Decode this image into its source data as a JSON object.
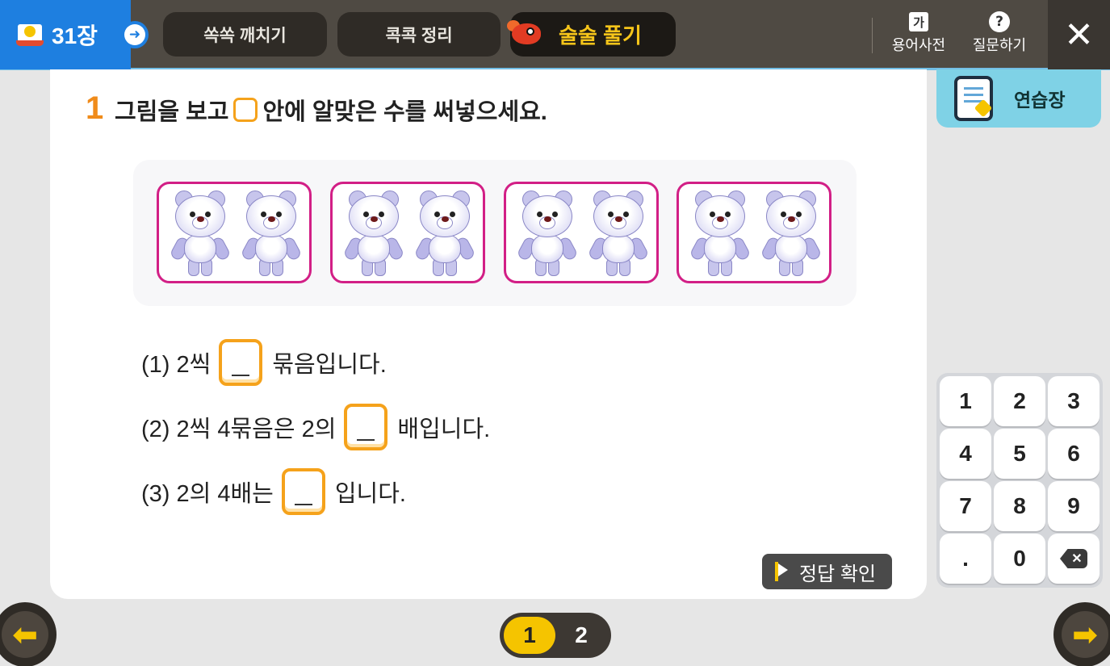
{
  "header": {
    "chapter": "31장",
    "tabs": [
      {
        "label": "쏙쏙 깨치기"
      },
      {
        "label": "콕콕 정리"
      },
      {
        "label": "술술 풀기"
      }
    ],
    "tools": {
      "dictionary_icon": "가",
      "dictionary_label": "용어사전",
      "question_icon": "?",
      "question_label": "질문하기"
    },
    "close": "✕"
  },
  "problem": {
    "number": "1",
    "instruction_before": "그림을 보고",
    "instruction_after": "안에 알맞은 수를 써넣으세요.",
    "groups": 4,
    "bears_per_group": 2,
    "sub_questions": [
      {
        "label": "(1) 2씩",
        "after": "묶음입니다."
      },
      {
        "label": "(2) 2씩 4묶음은 2의",
        "after": "배입니다."
      },
      {
        "label": "(3) 2의 4배는",
        "after": "입니다."
      }
    ],
    "check_answer": "정답 확인"
  },
  "workbook": {
    "label": "연습장"
  },
  "keypad": {
    "keys": [
      "1",
      "2",
      "3",
      "4",
      "5",
      "6",
      "7",
      "8",
      "9",
      ".",
      "0"
    ],
    "backspace": "✕"
  },
  "pager": {
    "pages": [
      "1",
      "2"
    ],
    "current": "1"
  },
  "icons": {
    "prev": "arrow-left-icon",
    "next": "arrow-right-icon"
  },
  "colors": {
    "accent_blue": "#1e7fe0",
    "topbar": "#4f4a43",
    "active_tab_text": "#f6c51a",
    "question_number": "#f08b1a",
    "group_border": "#d21f86",
    "answer_box": "#f5a21b",
    "workbook": "#7fd2e6"
  }
}
